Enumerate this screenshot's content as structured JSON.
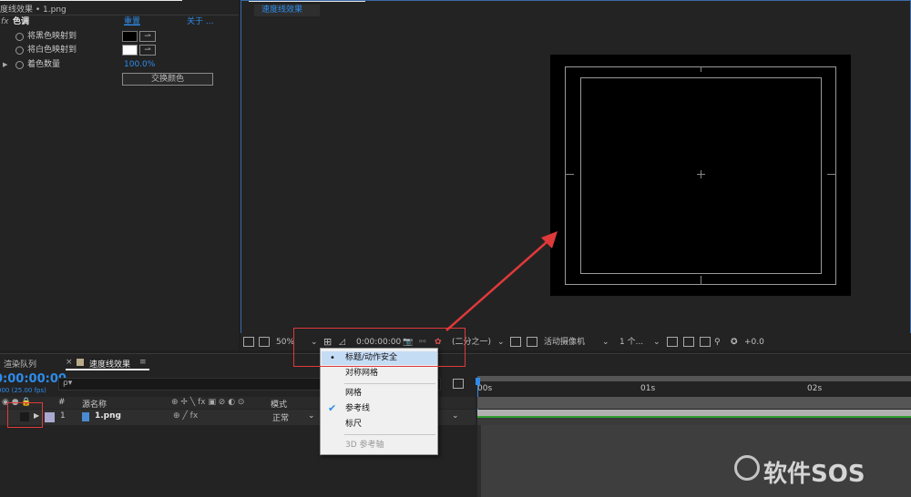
{
  "effects_panel": {
    "tab_title": "度线效果 • 1.png",
    "fx_label": "fx",
    "effect_name": "色调",
    "reset_label": "重置",
    "about_label": "关于 ...",
    "props": [
      {
        "label": "将黑色映射到",
        "color": "#000000"
      },
      {
        "label": "将白色映射到",
        "color": "#ffffff"
      },
      {
        "label": "着色数量",
        "value": "100.0%"
      }
    ],
    "swap_button": "交换颜色"
  },
  "viewer": {
    "comp_tab": "速度线效果",
    "toolbar": {
      "zoom": "50%",
      "timecode": "0:00:00:00",
      "resolution": "(二分之一)",
      "camera": "活动摄像机",
      "views": "1 个...",
      "exposure": "+0.0"
    }
  },
  "timeline": {
    "tabs": [
      "渲染队列",
      "速度线效果"
    ],
    "timecode": "0:00:00:00",
    "fps": "000 (25.00 fps)",
    "search_placeholder": "ρ▾",
    "columns": {
      "num": "#",
      "source_name": "源名称",
      "mode": "模式"
    },
    "layer": {
      "num": "1",
      "name": "1.png",
      "mode": "正常"
    },
    "ruler": [
      "00s",
      "01s",
      "02s"
    ]
  },
  "context_menu": {
    "items": [
      {
        "label": "标题/动作安全",
        "mark": "dot",
        "highlight": true
      },
      {
        "label": "对称网格",
        "mark": ""
      },
      {
        "label": "网格",
        "mark": ""
      },
      {
        "label": "参考线",
        "mark": "check"
      },
      {
        "label": "标尺",
        "mark": ""
      },
      {
        "label": "3D 参考轴",
        "mark": "",
        "disabled": true
      }
    ]
  },
  "watermark": "软件SOS",
  "colors": {
    "accent": "#2d8ceb",
    "annotation": "#e0393a"
  }
}
